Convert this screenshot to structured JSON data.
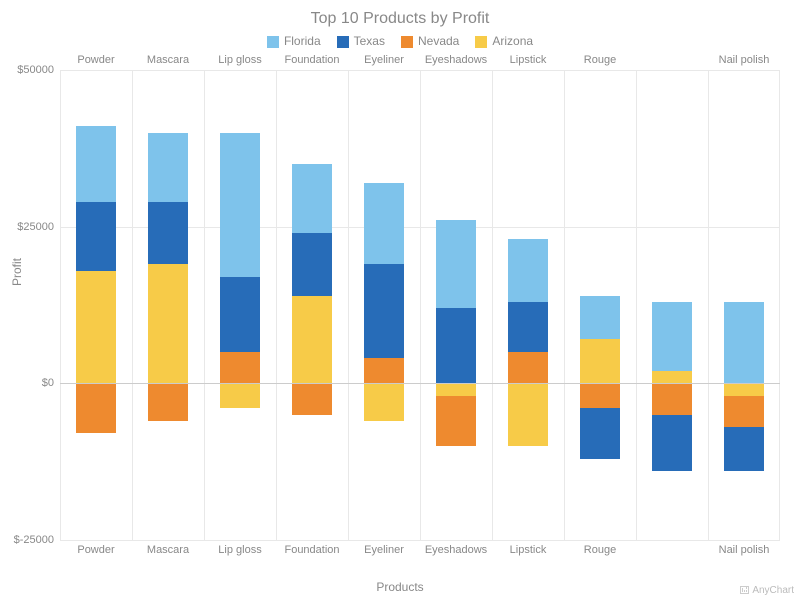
{
  "chart_data": {
    "type": "bar",
    "title": "Top 10 Products by Profit",
    "xlabel": "Products",
    "ylabel": "Profit",
    "ylim": [
      -25000,
      50000
    ],
    "yticks": [
      -25000,
      0,
      25000,
      50000
    ],
    "ytick_labels": [
      "$-25000",
      "$0",
      "$25000",
      "$50000"
    ],
    "categories": [
      "Powder",
      "Mascara",
      "Lip gloss",
      "Foundation",
      "Eyeliner",
      "Eyeshadows",
      "Lipstick",
      "Rouge",
      "",
      "Nail polish"
    ],
    "series": [
      {
        "name": "Florida",
        "color": "#7ec3eb",
        "values": [
          12000,
          11000,
          23000,
          11000,
          13000,
          14000,
          10000,
          7000,
          11000,
          13000
        ]
      },
      {
        "name": "Texas",
        "color": "#276cb8",
        "values": [
          11000,
          10000,
          12000,
          10000,
          15000,
          12000,
          8000,
          -8000,
          -9000,
          -7000
        ]
      },
      {
        "name": "Nevada",
        "color": "#ee8a2f",
        "values": [
          -8000,
          -6000,
          5000,
          -5000,
          4000,
          -8000,
          5000,
          -4000,
          -5000,
          -5000
        ]
      },
      {
        "name": "Arizona",
        "color": "#f7cb48",
        "values": [
          18000,
          19000,
          -4000,
          14000,
          -6000,
          -2000,
          -10000,
          7000,
          2000,
          -2000
        ]
      }
    ]
  },
  "credit": "AnyChart"
}
